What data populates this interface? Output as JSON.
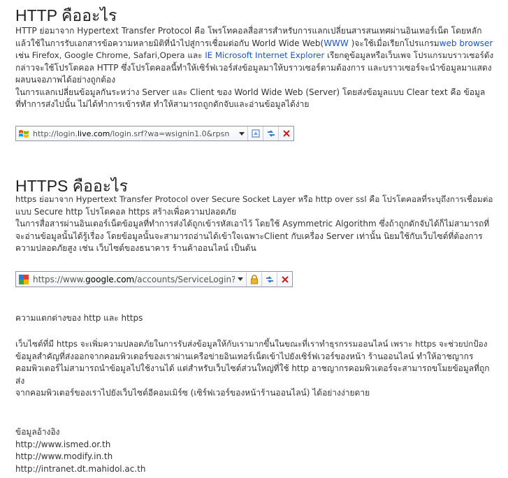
{
  "section_http": {
    "title": "HTTP คืออะไร",
    "lines": [
      "HTTP ย่อมาจาก Hypertext Transfer Protocol คือ โพรโทคอลสื่อสารสำหรับการแลกเปลี่ยนสารสนเทศผ่านอินเทอร์เน็ต โดยหลัก",
      "แล้วใช้ในการรับเอกสารข้อความหลายมิติที่นำไปสู่การเชื่อมต่อกับ World Wide Web(",
      "เช่น Firefox, Google Chrome, Safari,Opera และ ",
      "กล่าวจะใช้โปรโตคอล HTTP ซึ่งโปรโตคอลนี้ทำให้เซิร์ฟเวอร์ส่งข้อมูลมาให้บราวเซอร์ตามต้องการ และบราวเซอร์จะนำข้อมูลมาแสดง",
      "ผลบนจอภาพได้อย่างถูกต้อง",
      "ในการแลกเปลี่ยนข้อมูลกันระหว่าง Server และ Client ของ World Wide Web (Server) โดยส่งข้อมูลแบบ Clear text คือ ข้อมูล",
      "ที่ทำการส่งไปนั้น ไม่ได้ทำการเข้ารหัส ทำให้สามารถถูกดักจับและอ่านข้อมูลได้ง่าย"
    ],
    "line2_link": "WWW",
    "line2_after": " )จะใช้เมื่อเรียกโปรแกรม",
    "line2_link2": "web browser",
    "line3_link": "IE Microsoft Internet Explorer",
    "line3_after": " เรียกดูข้อมูลหรือเว็บเพจ โปรแกรมบราวเซอร์ดัง"
  },
  "address_bar_1": {
    "url_prefix": "http://login.",
    "url_domain": "live.com",
    "url_suffix": "/login.srf?wa=wsignin1.0&rpsn"
  },
  "section_https": {
    "title": "HTTPS คืออะไร",
    "lines": [
      "https ย่อมาจาก Hypertext Transfer Protocol over Secure Socket Layer หรือ http over ssl คือ โปรโตคอลที่ระบุถึงการเชื่อมต่อ",
      "แบบ Secure http โปรโตคอล https สร้างเพื่อความปลอดภัย",
      "ในการสื่อสารผ่านอินเตอร์เน็ตข้อมูลที่ทำการส่งได้ถูกเข้ารหัสเอาไว้ โดยใช้ Asymmetric Algorithm ซึ่งถ้าถูกดักจับได้ก็ไม่สามารถที่",
      "จะอ่านข้อมูลนั้นได้รู้เรื่อง โดยข้อมูลนั้นจะสามารถอ่านได้เข้าใจเฉพาะClient กับเครื่อง Server เท่านั้น นิยมใช้กับเว็บไซต์ที่ต้องการ",
      "ความปลอดภัยสูง เช่น เว็บไซต์ของธนาคาร ร้านค้าออนไลน์ เป็นต้น"
    ]
  },
  "address_bar_2": {
    "url_prefix": "https://www.",
    "url_domain": "google.com",
    "url_suffix": "/accounts/ServiceLogin?se"
  },
  "section_diff": {
    "heading": "ความแตกต่างของ http และ https",
    "lines": [
      "เว็บไซต์ที่มี https จะเพิ่มความปลอดภัยในการรับส่งข้อมูลให้กับเรามากขึ้นในขณะที่เราทำธุรกรรมออนไลน์ เพราะ https จะช่วยปกป้อง",
      "ข้อมูลสำคัญที่ส่งออกจากคอมพิวเตอร์ของเราผ่านเครือข่ายอินเทอร์เน็ตเข้าไปยังเซิร์ฟเวอร์ของหน้า ร้านออนไลน์ ทำให้อาชญากร",
      "คอมพิวเตอร์ไม่สามารถนำข้อมูลไปใช้งานได้ แต่สำหรับเว็บไซต์ส่วนใหญ่ที่ใช้ http อาชญากรคอมพิวเตอร์จะสามารถขโมยข้อมูลที่ถูก",
      "ส่ง",
      "จากคอมพิวเตอร์ของเราไปยังเว็บไซต์อีคอมเมิร์ซ (เซิร์ฟเวอร์ของหน้าร้านออนไลน์) ได้อย่างง่ายดาย"
    ]
  },
  "references": {
    "heading": "ข้อมูลอ้างอิง",
    "links": [
      "http://www.ismed.or.th",
      "http://www.modify.in.th",
      "http://intranet.dt.mahidol.ac.th"
    ]
  },
  "colors": {
    "link": "#1a55c4",
    "text": "#333333"
  },
  "icons": {
    "bar1_favicon": "windows-flag-icon",
    "bar2_favicon": "google-icon"
  }
}
